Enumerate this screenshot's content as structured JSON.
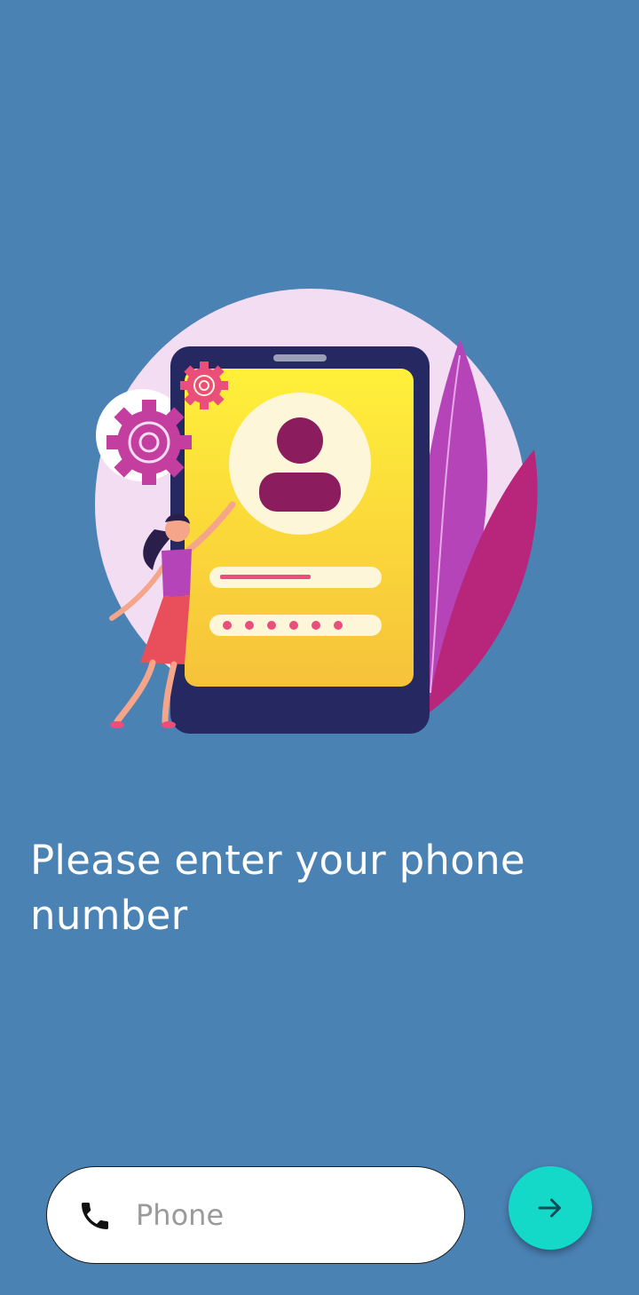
{
  "prompt": {
    "title": "Please enter your phone number"
  },
  "phone_input": {
    "placeholder": "Phone",
    "value": "",
    "icon": "phone-icon"
  },
  "next_button": {
    "icon": "arrow-right-icon"
  },
  "illustration": {
    "name": "phone-login-illustration"
  },
  "colors": {
    "background": "#4a82b4",
    "accent": "#14d9c9",
    "text": "#ffffff",
    "field_bg": "#ffffff"
  }
}
